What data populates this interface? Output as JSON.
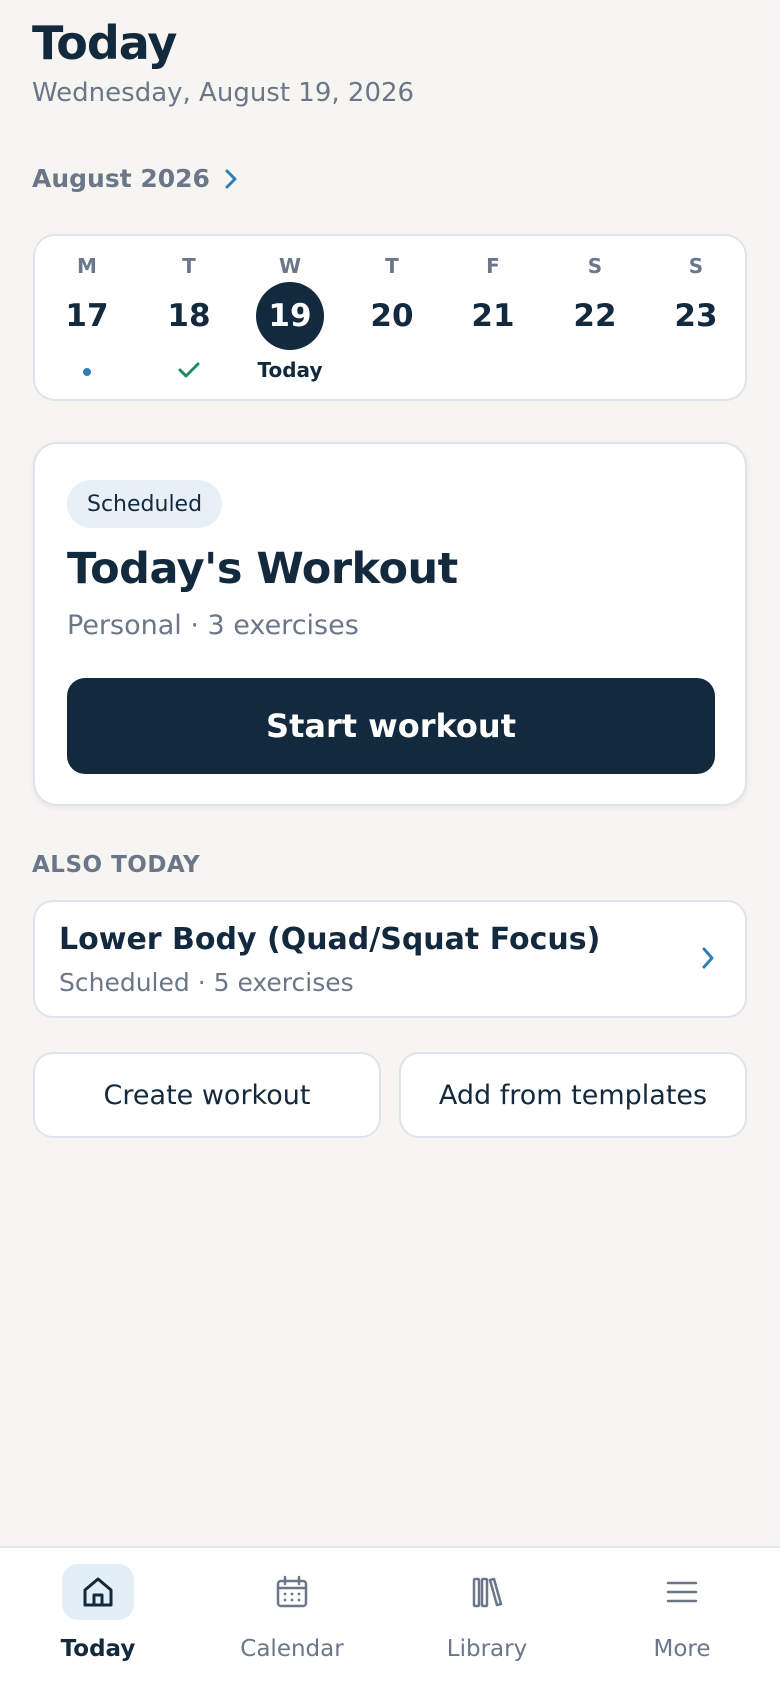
{
  "header": {
    "title": "Today",
    "date": "Wednesday, August 19, 2026"
  },
  "calendar": {
    "month_label": "August 2026",
    "days": [
      {
        "letter": "M",
        "number": "17",
        "marker": "dot"
      },
      {
        "letter": "T",
        "number": "18",
        "marker": "check"
      },
      {
        "letter": "W",
        "number": "19",
        "marker": "today",
        "selected": true
      },
      {
        "letter": "T",
        "number": "20",
        "marker": "none"
      },
      {
        "letter": "F",
        "number": "21",
        "marker": "none"
      },
      {
        "letter": "S",
        "number": "22",
        "marker": "none"
      },
      {
        "letter": "S",
        "number": "23",
        "marker": "none"
      }
    ],
    "today_label": "Today"
  },
  "workout_card": {
    "status": "Scheduled",
    "title": "Today's Workout",
    "meta": "Personal · 3 exercises",
    "start_label": "Start workout"
  },
  "also_today": {
    "section_label": "ALSO TODAY",
    "items": [
      {
        "title": "Lower Body (Quad/Squat Focus)",
        "meta": "Scheduled · 5 exercises"
      }
    ]
  },
  "actions": {
    "create_label": "Create workout",
    "templates_label": "Add from templates"
  },
  "bottom_nav": {
    "items": [
      {
        "label": "Today",
        "icon": "home-icon",
        "active": true
      },
      {
        "label": "Calendar",
        "icon": "calendar-icon",
        "active": false
      },
      {
        "label": "Library",
        "icon": "library-icon",
        "active": false
      },
      {
        "label": "More",
        "icon": "menu-icon",
        "active": false
      }
    ]
  },
  "colors": {
    "background": "#f6f5f1",
    "primary": "#13293d",
    "accent": "#2f7fb5",
    "success": "#1f8a6a",
    "muted": "#6b7789"
  }
}
